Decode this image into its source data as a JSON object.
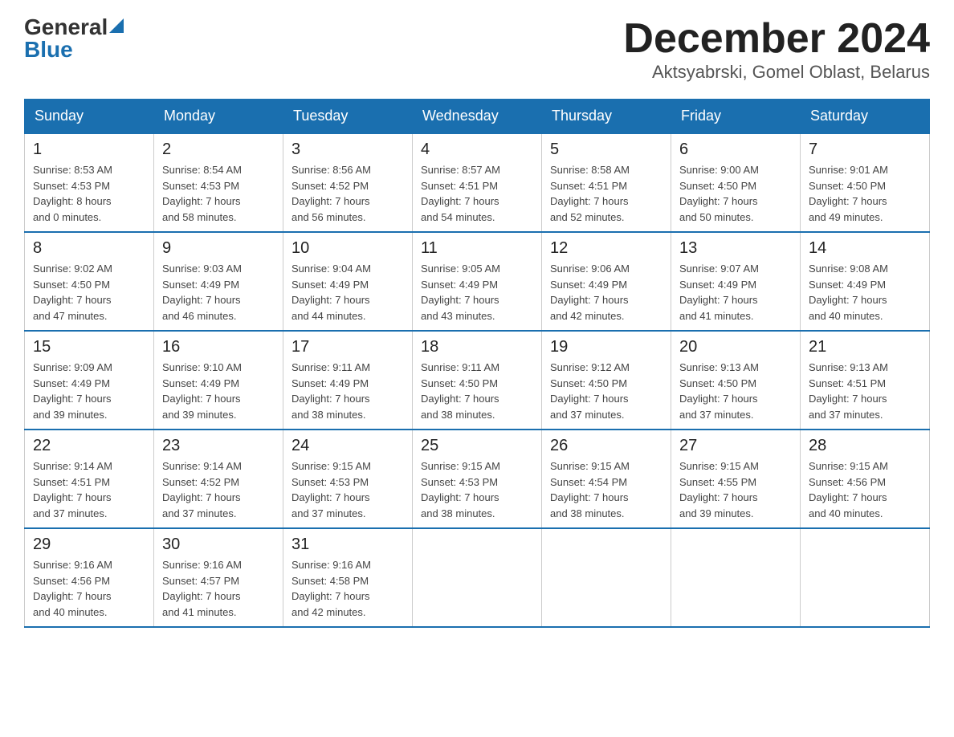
{
  "header": {
    "logo_general": "General",
    "logo_blue": "Blue",
    "month_title": "December 2024",
    "location": "Aktsyabrski, Gomel Oblast, Belarus"
  },
  "days_of_week": [
    "Sunday",
    "Monday",
    "Tuesday",
    "Wednesday",
    "Thursday",
    "Friday",
    "Saturday"
  ],
  "weeks": [
    [
      {
        "day": "1",
        "info": "Sunrise: 8:53 AM\nSunset: 4:53 PM\nDaylight: 8 hours\nand 0 minutes."
      },
      {
        "day": "2",
        "info": "Sunrise: 8:54 AM\nSunset: 4:53 PM\nDaylight: 7 hours\nand 58 minutes."
      },
      {
        "day": "3",
        "info": "Sunrise: 8:56 AM\nSunset: 4:52 PM\nDaylight: 7 hours\nand 56 minutes."
      },
      {
        "day": "4",
        "info": "Sunrise: 8:57 AM\nSunset: 4:51 PM\nDaylight: 7 hours\nand 54 minutes."
      },
      {
        "day": "5",
        "info": "Sunrise: 8:58 AM\nSunset: 4:51 PM\nDaylight: 7 hours\nand 52 minutes."
      },
      {
        "day": "6",
        "info": "Sunrise: 9:00 AM\nSunset: 4:50 PM\nDaylight: 7 hours\nand 50 minutes."
      },
      {
        "day": "7",
        "info": "Sunrise: 9:01 AM\nSunset: 4:50 PM\nDaylight: 7 hours\nand 49 minutes."
      }
    ],
    [
      {
        "day": "8",
        "info": "Sunrise: 9:02 AM\nSunset: 4:50 PM\nDaylight: 7 hours\nand 47 minutes."
      },
      {
        "day": "9",
        "info": "Sunrise: 9:03 AM\nSunset: 4:49 PM\nDaylight: 7 hours\nand 46 minutes."
      },
      {
        "day": "10",
        "info": "Sunrise: 9:04 AM\nSunset: 4:49 PM\nDaylight: 7 hours\nand 44 minutes."
      },
      {
        "day": "11",
        "info": "Sunrise: 9:05 AM\nSunset: 4:49 PM\nDaylight: 7 hours\nand 43 minutes."
      },
      {
        "day": "12",
        "info": "Sunrise: 9:06 AM\nSunset: 4:49 PM\nDaylight: 7 hours\nand 42 minutes."
      },
      {
        "day": "13",
        "info": "Sunrise: 9:07 AM\nSunset: 4:49 PM\nDaylight: 7 hours\nand 41 minutes."
      },
      {
        "day": "14",
        "info": "Sunrise: 9:08 AM\nSunset: 4:49 PM\nDaylight: 7 hours\nand 40 minutes."
      }
    ],
    [
      {
        "day": "15",
        "info": "Sunrise: 9:09 AM\nSunset: 4:49 PM\nDaylight: 7 hours\nand 39 minutes."
      },
      {
        "day": "16",
        "info": "Sunrise: 9:10 AM\nSunset: 4:49 PM\nDaylight: 7 hours\nand 39 minutes."
      },
      {
        "day": "17",
        "info": "Sunrise: 9:11 AM\nSunset: 4:49 PM\nDaylight: 7 hours\nand 38 minutes."
      },
      {
        "day": "18",
        "info": "Sunrise: 9:11 AM\nSunset: 4:50 PM\nDaylight: 7 hours\nand 38 minutes."
      },
      {
        "day": "19",
        "info": "Sunrise: 9:12 AM\nSunset: 4:50 PM\nDaylight: 7 hours\nand 37 minutes."
      },
      {
        "day": "20",
        "info": "Sunrise: 9:13 AM\nSunset: 4:50 PM\nDaylight: 7 hours\nand 37 minutes."
      },
      {
        "day": "21",
        "info": "Sunrise: 9:13 AM\nSunset: 4:51 PM\nDaylight: 7 hours\nand 37 minutes."
      }
    ],
    [
      {
        "day": "22",
        "info": "Sunrise: 9:14 AM\nSunset: 4:51 PM\nDaylight: 7 hours\nand 37 minutes."
      },
      {
        "day": "23",
        "info": "Sunrise: 9:14 AM\nSunset: 4:52 PM\nDaylight: 7 hours\nand 37 minutes."
      },
      {
        "day": "24",
        "info": "Sunrise: 9:15 AM\nSunset: 4:53 PM\nDaylight: 7 hours\nand 37 minutes."
      },
      {
        "day": "25",
        "info": "Sunrise: 9:15 AM\nSunset: 4:53 PM\nDaylight: 7 hours\nand 38 minutes."
      },
      {
        "day": "26",
        "info": "Sunrise: 9:15 AM\nSunset: 4:54 PM\nDaylight: 7 hours\nand 38 minutes."
      },
      {
        "day": "27",
        "info": "Sunrise: 9:15 AM\nSunset: 4:55 PM\nDaylight: 7 hours\nand 39 minutes."
      },
      {
        "day": "28",
        "info": "Sunrise: 9:15 AM\nSunset: 4:56 PM\nDaylight: 7 hours\nand 40 minutes."
      }
    ],
    [
      {
        "day": "29",
        "info": "Sunrise: 9:16 AM\nSunset: 4:56 PM\nDaylight: 7 hours\nand 40 minutes."
      },
      {
        "day": "30",
        "info": "Sunrise: 9:16 AM\nSunset: 4:57 PM\nDaylight: 7 hours\nand 41 minutes."
      },
      {
        "day": "31",
        "info": "Sunrise: 9:16 AM\nSunset: 4:58 PM\nDaylight: 7 hours\nand 42 minutes."
      },
      {
        "day": "",
        "info": ""
      },
      {
        "day": "",
        "info": ""
      },
      {
        "day": "",
        "info": ""
      },
      {
        "day": "",
        "info": ""
      }
    ]
  ]
}
